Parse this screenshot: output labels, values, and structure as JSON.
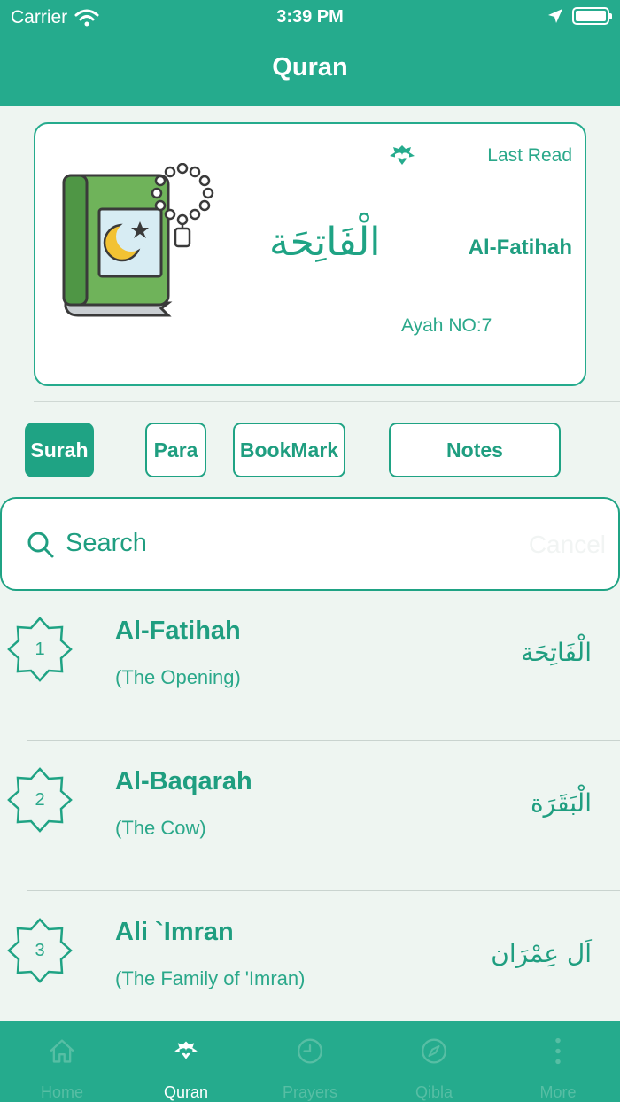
{
  "status_bar": {
    "carrier": "Carrier",
    "time": "3:39 PM"
  },
  "nav": {
    "title": "Quran"
  },
  "last_read": {
    "label": "Last Read",
    "arabic": "الْفَاتِحَة",
    "surah": "Al-Fatihah",
    "ayah": "Ayah NO:7"
  },
  "tabs": [
    {
      "label": "Surah",
      "active": true
    },
    {
      "label": "Para",
      "active": false
    },
    {
      "label": "BookMark",
      "active": false
    },
    {
      "label": "Notes",
      "active": false
    }
  ],
  "search": {
    "placeholder": "Search",
    "cancel": "Cancel"
  },
  "surahs": [
    {
      "number": "1",
      "name": "Al-Fatihah",
      "meaning": "(The Opening)",
      "arabic": "الْفَاتِحَة"
    },
    {
      "number": "2",
      "name": "Al-Baqarah",
      "meaning": "(The Cow)",
      "arabic": "الْبَقَرَة"
    },
    {
      "number": "3",
      "name": "Ali `Imran",
      "meaning": "(The Family of 'Imran)",
      "arabic": "اَل عِمْرَان"
    }
  ],
  "tabbar": [
    {
      "label": "Home",
      "icon": "home-icon"
    },
    {
      "label": "Quran",
      "icon": "quran-icon"
    },
    {
      "label": "Prayers",
      "icon": "clock-icon"
    },
    {
      "label": "Qibla",
      "icon": "compass-icon"
    },
    {
      "label": "More",
      "icon": "more-icon"
    }
  ],
  "colors": {
    "primary": "#25ab8d",
    "text": "#1f9e80",
    "background": "#eef5f1"
  }
}
